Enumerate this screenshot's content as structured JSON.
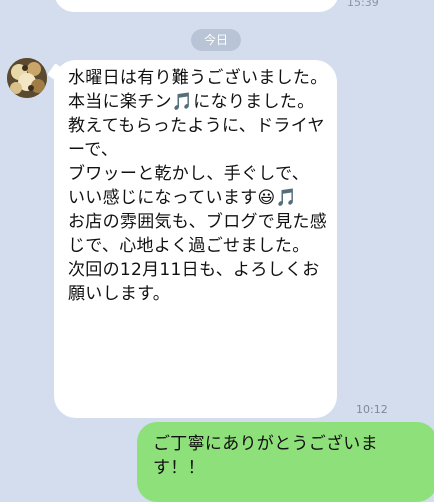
{
  "previous_message": {
    "time": "15:39"
  },
  "date_divider": "今日",
  "incoming": {
    "text": "水曜日は有り難うございました。\n本当に楽チン🎵になりました。\n教えてもらったように、ドライヤーで、\nブワッーと乾かし、手ぐしで、\nいい感じになっています😃🎵\nお店の雰囲気も、ブログで見た感じで、心地よく過ごせました。\n次回の12月11日も、よろしくお願いします。",
    "time": "10:12"
  },
  "outgoing": {
    "text": "ご丁寧にありがとうございます！！"
  }
}
